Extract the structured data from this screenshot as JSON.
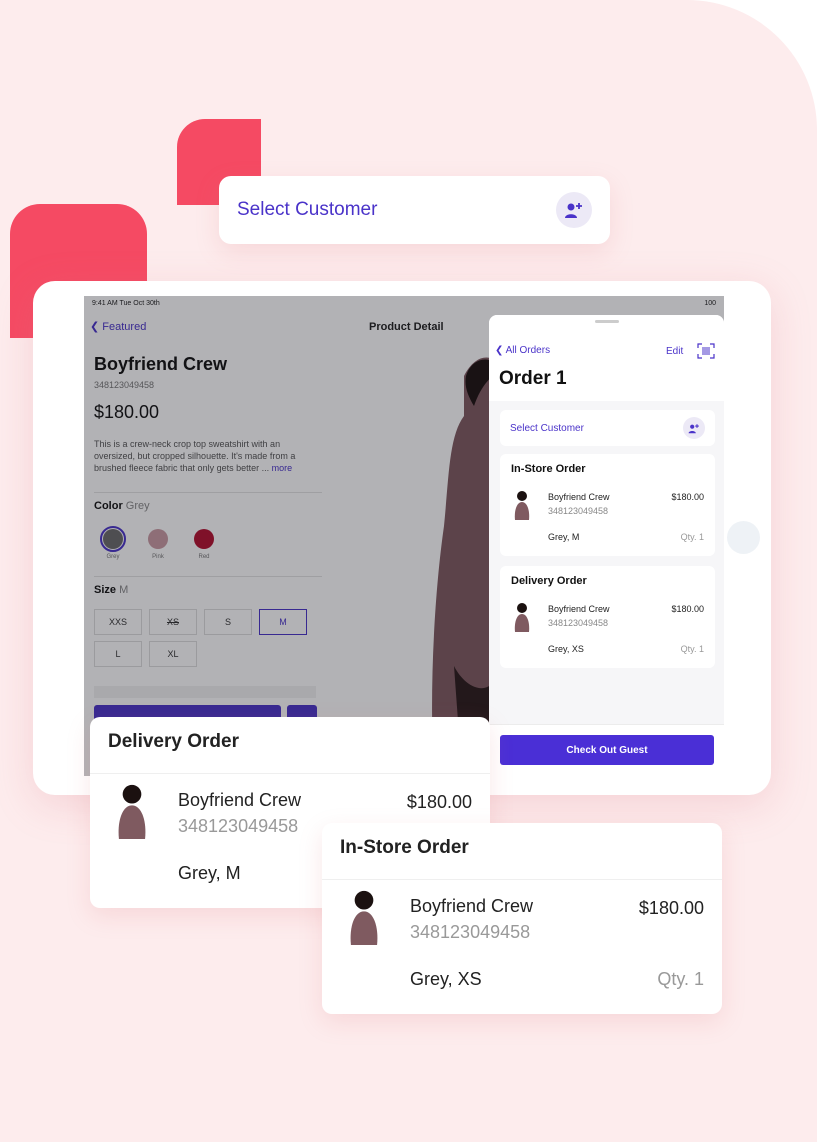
{
  "select_customer": {
    "label": "Select Customer",
    "icon": "add-user-icon"
  },
  "statusbar": {
    "time": "9:41 AM  Tue Oct 30th",
    "right": "100"
  },
  "product": {
    "nav_back": "Featured",
    "nav_title": "Product Detail",
    "title": "Boyfriend Crew",
    "sku": "348123049458",
    "price": "$180.00",
    "description": "This is a crew-neck crop top sweatshirt with an oversized, but cropped silhouette.  It's made from a brushed fleece fabric that only gets better ...",
    "more": "more",
    "color_label": "Color",
    "color_value": "Grey",
    "colors": [
      {
        "label": "Grey",
        "hex": "#6b6b6b"
      },
      {
        "label": "Pink",
        "hex": "#c99aa3"
      },
      {
        "label": "Red",
        "hex": "#b4102f"
      }
    ],
    "size_label": "Size",
    "size_value": "M",
    "sizes": [
      "XXS",
      "XS",
      "S",
      "M",
      "L",
      "XL"
    ]
  },
  "sheet": {
    "back": "All Orders",
    "edit": "Edit",
    "title": "Order 1",
    "select_customer": "Select Customer",
    "orders": [
      {
        "heading": "In-Store Order",
        "name": "Boyfriend Crew",
        "sku": "348123049458",
        "price": "$180.00",
        "variant": "Grey, M",
        "qty": "Qty. 1"
      },
      {
        "heading": "Delivery Order",
        "name": "Boyfriend Crew",
        "sku": "348123049458",
        "price": "$180.00",
        "variant": "Grey, XS",
        "qty": "Qty. 1"
      }
    ],
    "checkout": "Check Out Guest"
  },
  "delivery_card": {
    "heading": "Delivery Order",
    "name": "Boyfriend Crew",
    "sku": "348123049458",
    "price": "$180.00",
    "variant": "Grey, M"
  },
  "instore_card": {
    "heading": "In-Store Order",
    "name": "Boyfriend Crew",
    "sku": "348123049458",
    "price": "$180.00",
    "variant": "Grey, XS",
    "qty": "Qty. 1"
  },
  "colors": {
    "accent": "#4a33c9",
    "deco": "#f54a63",
    "background": "#fdeced"
  }
}
